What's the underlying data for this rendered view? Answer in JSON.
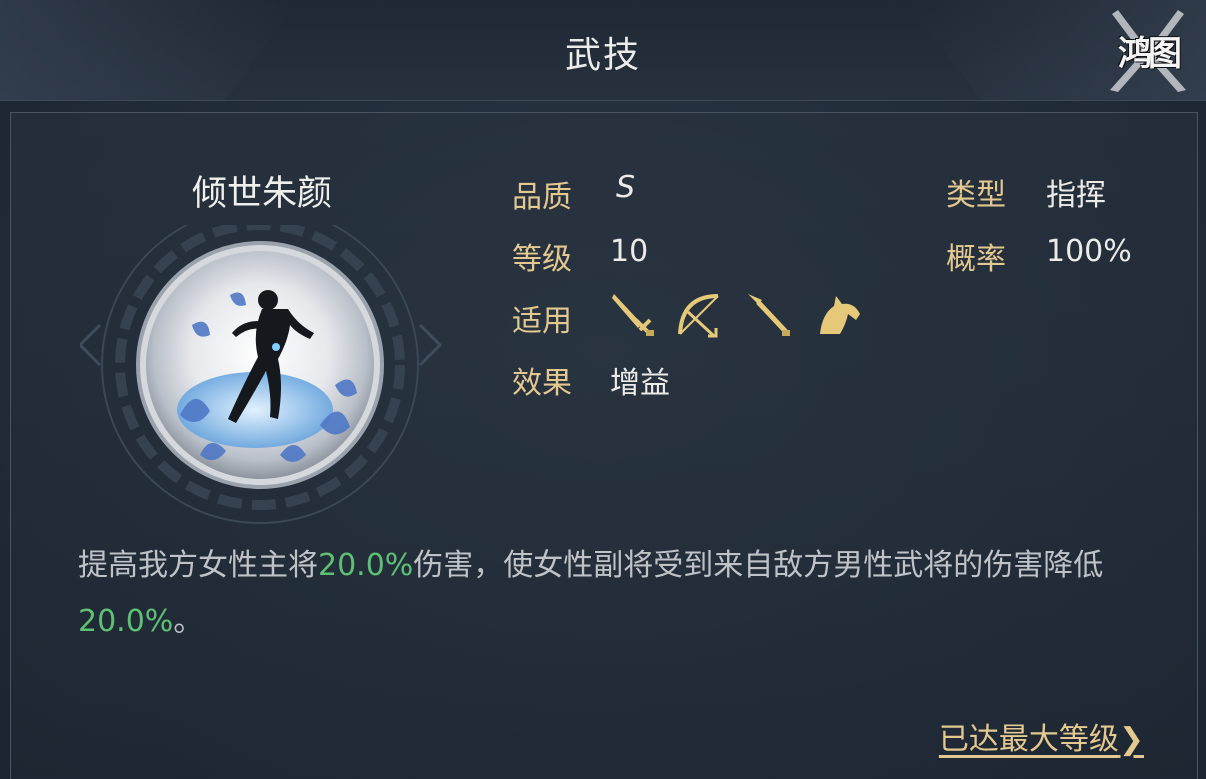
{
  "header": {
    "title": "武技",
    "logo_text": "鸿图"
  },
  "skill": {
    "name": "倾世朱颜",
    "quality_label": "品质",
    "quality_value": "S",
    "level_label": "等级",
    "level_value": "10",
    "applicable_label": "适用",
    "applicable_icons": [
      "sword-icon",
      "bow-icon",
      "spear-icon",
      "horse-icon"
    ],
    "effect_label": "效果",
    "effect_value": "增益",
    "type_label": "类型",
    "type_value": "指挥",
    "chance_label": "概率",
    "chance_value": "100%"
  },
  "description": {
    "part1": "提高我方女性主将",
    "value1": "20.0%",
    "part2": "伤害，使女性副将受到来自敌方男性武将的伤害降低",
    "value2": "20.0%",
    "part3": "。"
  },
  "footer": {
    "max_level_text": "已达最大等级",
    "arrow": "❯"
  },
  "colors": {
    "label_gold": "#e3c88f",
    "highlight_green": "#5fbf74",
    "icon_gold": "#e6c978"
  }
}
